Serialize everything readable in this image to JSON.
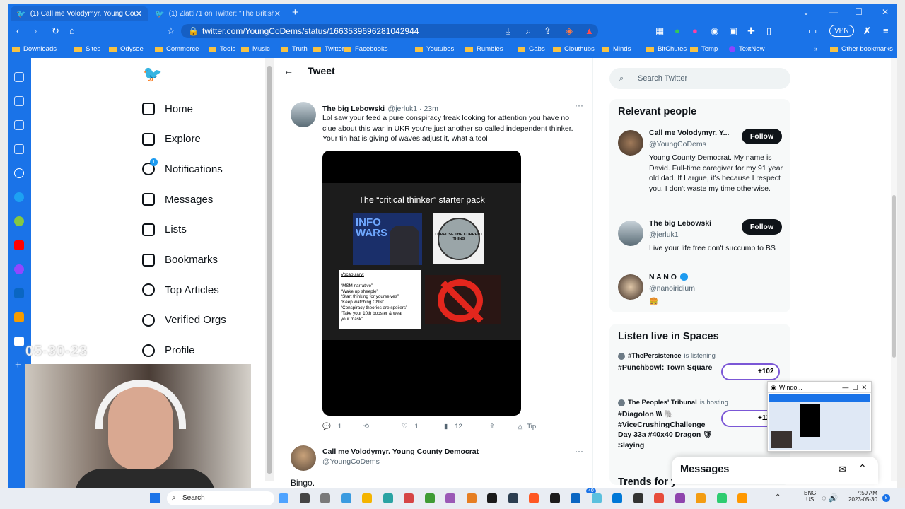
{
  "browser": {
    "tabs": [
      {
        "label": "(1) Call me Volodymyr. Young County",
        "active": true
      },
      {
        "label": "(1) Zlatti71 on Twitter: \"The British-assem",
        "active": false
      }
    ],
    "url": "twitter.com/YoungCoDems/status/1663539696281042944",
    "vpn_label": "VPN",
    "bookmarks": [
      "Downloads",
      "Sites",
      "Odysee",
      "Commerce",
      "Tools",
      "Music",
      "Truth",
      "Twitters",
      "Facebooks",
      "Youtubes",
      "Rumbles",
      "Gabs",
      "Clouthubs",
      "Minds",
      "BitChutes",
      "Temp",
      "TextNow"
    ],
    "other_bookmarks": "Other bookmarks",
    "more_bookmarks": "»"
  },
  "nav": {
    "items": [
      {
        "label": "Home",
        "icon": "home-icon"
      },
      {
        "label": "Explore",
        "icon": "hashtag-icon"
      },
      {
        "label": "Notifications",
        "icon": "bell-icon",
        "badge": "1"
      },
      {
        "label": "Messages",
        "icon": "mail-icon"
      },
      {
        "label": "Lists",
        "icon": "list-icon"
      },
      {
        "label": "Bookmarks",
        "icon": "bookmark-icon"
      },
      {
        "label": "Top Articles",
        "icon": "fire-icon"
      },
      {
        "label": "Verified Orgs",
        "icon": "verified-icon"
      },
      {
        "label": "Profile",
        "icon": "profile-icon"
      }
    ]
  },
  "header": {
    "title": "Tweet",
    "back": "←"
  },
  "tweet": {
    "name": "The big Lebowski",
    "handle": "@jerluk1 · 23m",
    "more": "···",
    "text": "Lol saw your feed a pure conspiracy freak looking for attention you have no clue about this war in UKR you're just another so called independent thinker. Your tin hat is giving of waves adjust it, what a tool",
    "media": {
      "title": "The “critical thinker” starter pack",
      "logo": "INFO WARS",
      "badge_text": "I OPPOSE THE CURRENT THING",
      "vocab_title": "Vocabulary:",
      "vocab_lines": [
        "“MSM narrative”",
        "“Wake up sheeple”",
        "“Start thinking for yourselves”",
        "“Keep watching CNN”",
        "“Conspiracy theories are spoilers”",
        "“Take your 10th booster & wear",
        "your mask”"
      ]
    },
    "replies": "1",
    "retweets": "",
    "likes": "1",
    "views": "12",
    "tip": "Tip"
  },
  "reply": {
    "name": "Call me Volodymyr. Young County Democrat",
    "handle": "@YoungCoDems",
    "more": "···",
    "text": "Bingo."
  },
  "search": {
    "placeholder": "Search Twitter"
  },
  "relevant": {
    "title": "Relevant people",
    "people": [
      {
        "name": "Call me Volodymyr. Y...",
        "handle": "@YoungCoDems",
        "follow": "Follow",
        "bio": "Young County Democrat. My name is David. Full-time caregiver for my 91 year old dad. If I argue, it's because I respect you. I don't waste my time otherwise."
      },
      {
        "name": "The big Lebowski",
        "handle": "@jerluk1",
        "follow": "Follow",
        "bio": "Live your life free don't succumb to BS"
      },
      {
        "name": "N A N O",
        "handle": "@nanoiridium",
        "follow": "",
        "bio": "🍔"
      }
    ]
  },
  "spaces": {
    "title": "Listen live in Spaces",
    "items": [
      {
        "host": "#ThePersistence",
        "status": "is listening",
        "title": "#Punchbowl: Town Square",
        "count": "+102"
      },
      {
        "host": "The Peoples' Tribunal",
        "status": "is hosting",
        "title": "#Diagolon \\\\\\ 🐘 #ViceCrushingChallenge Day 33a #40x40 Dragon 🛡Slaying",
        "count": "+12"
      }
    ]
  },
  "trends": {
    "title": "Trends for y"
  },
  "messages": {
    "title": "Messages"
  },
  "popup": {
    "title": "Windo..."
  },
  "webcam": {
    "date": "05-30-23"
  },
  "taskbar": {
    "search": "Search",
    "lang1": "ENG",
    "lang2": "US",
    "time": "7:59 AM",
    "date": "2023-05-30",
    "notif": "8",
    "badge40": "40"
  }
}
